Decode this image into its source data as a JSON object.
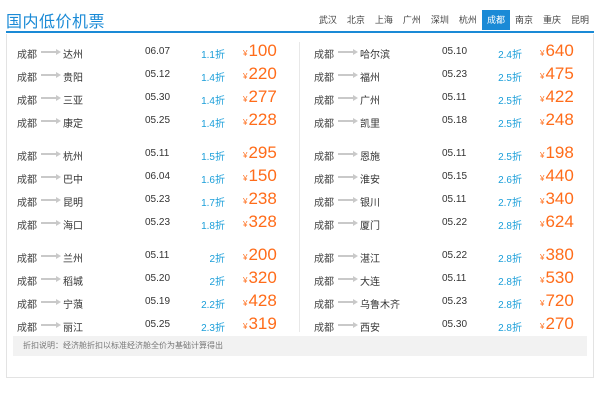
{
  "header": {
    "title": "国内低价机票",
    "cities": [
      "武汉",
      "北京",
      "上海",
      "广州",
      "深圳",
      "杭州",
      "成都",
      "南京",
      "重庆",
      "昆明"
    ],
    "active_city": "成都"
  },
  "colors": {
    "accent": "#1a8ad6",
    "discount": "#1a9ed9",
    "price": "#ff6c1a"
  },
  "currency_symbol": "¥",
  "left_groups": [
    [
      {
        "from": "成都",
        "to": "达州",
        "date": "06.07",
        "discount": "1.1折",
        "price": "100"
      },
      {
        "from": "成都",
        "to": "贵阳",
        "date": "05.12",
        "discount": "1.4折",
        "price": "220"
      },
      {
        "from": "成都",
        "to": "三亚",
        "date": "05.30",
        "discount": "1.4折",
        "price": "277"
      },
      {
        "from": "成都",
        "to": "康定",
        "date": "05.25",
        "discount": "1.4折",
        "price": "228"
      }
    ],
    [
      {
        "from": "成都",
        "to": "杭州",
        "date": "05.11",
        "discount": "1.5折",
        "price": "295"
      },
      {
        "from": "成都",
        "to": "巴中",
        "date": "06.04",
        "discount": "1.6折",
        "price": "150"
      },
      {
        "from": "成都",
        "to": "昆明",
        "date": "05.23",
        "discount": "1.7折",
        "price": "238"
      },
      {
        "from": "成都",
        "to": "海口",
        "date": "05.23",
        "discount": "1.8折",
        "price": "328"
      }
    ],
    [
      {
        "from": "成都",
        "to": "兰州",
        "date": "05.11",
        "discount": "2折",
        "price": "200"
      },
      {
        "from": "成都",
        "to": "稻城",
        "date": "05.20",
        "discount": "2折",
        "price": "320"
      },
      {
        "from": "成都",
        "to": "宁蒗",
        "date": "05.19",
        "discount": "2.2折",
        "price": "428"
      },
      {
        "from": "成都",
        "to": "丽江",
        "date": "05.25",
        "discount": "2.3折",
        "price": "319"
      }
    ]
  ],
  "right_groups": [
    [
      {
        "from": "成都",
        "to": "哈尔滨",
        "date": "05.10",
        "discount": "2.4折",
        "price": "640"
      },
      {
        "from": "成都",
        "to": "福州",
        "date": "05.23",
        "discount": "2.5折",
        "price": "475"
      },
      {
        "from": "成都",
        "to": "广州",
        "date": "05.11",
        "discount": "2.5折",
        "price": "422"
      },
      {
        "from": "成都",
        "to": "凯里",
        "date": "05.18",
        "discount": "2.5折",
        "price": "248"
      }
    ],
    [
      {
        "from": "成都",
        "to": "恩施",
        "date": "05.11",
        "discount": "2.5折",
        "price": "198"
      },
      {
        "from": "成都",
        "to": "淮安",
        "date": "05.15",
        "discount": "2.6折",
        "price": "440"
      },
      {
        "from": "成都",
        "to": "银川",
        "date": "05.11",
        "discount": "2.7折",
        "price": "340"
      },
      {
        "from": "成都",
        "to": "厦门",
        "date": "05.22",
        "discount": "2.8折",
        "price": "624"
      }
    ],
    [
      {
        "from": "成都",
        "to": "湛江",
        "date": "05.22",
        "discount": "2.8折",
        "price": "380"
      },
      {
        "from": "成都",
        "to": "大连",
        "date": "05.11",
        "discount": "2.8折",
        "price": "530"
      },
      {
        "from": "成都",
        "to": "乌鲁木齐",
        "date": "05.23",
        "discount": "2.8折",
        "price": "720"
      },
      {
        "from": "成都",
        "to": "西安",
        "date": "05.30",
        "discount": "2.8折",
        "price": "270"
      }
    ]
  ],
  "footer": {
    "note": "折扣说明：经济舱折扣以标准经济舱全价为基础计算得出"
  }
}
